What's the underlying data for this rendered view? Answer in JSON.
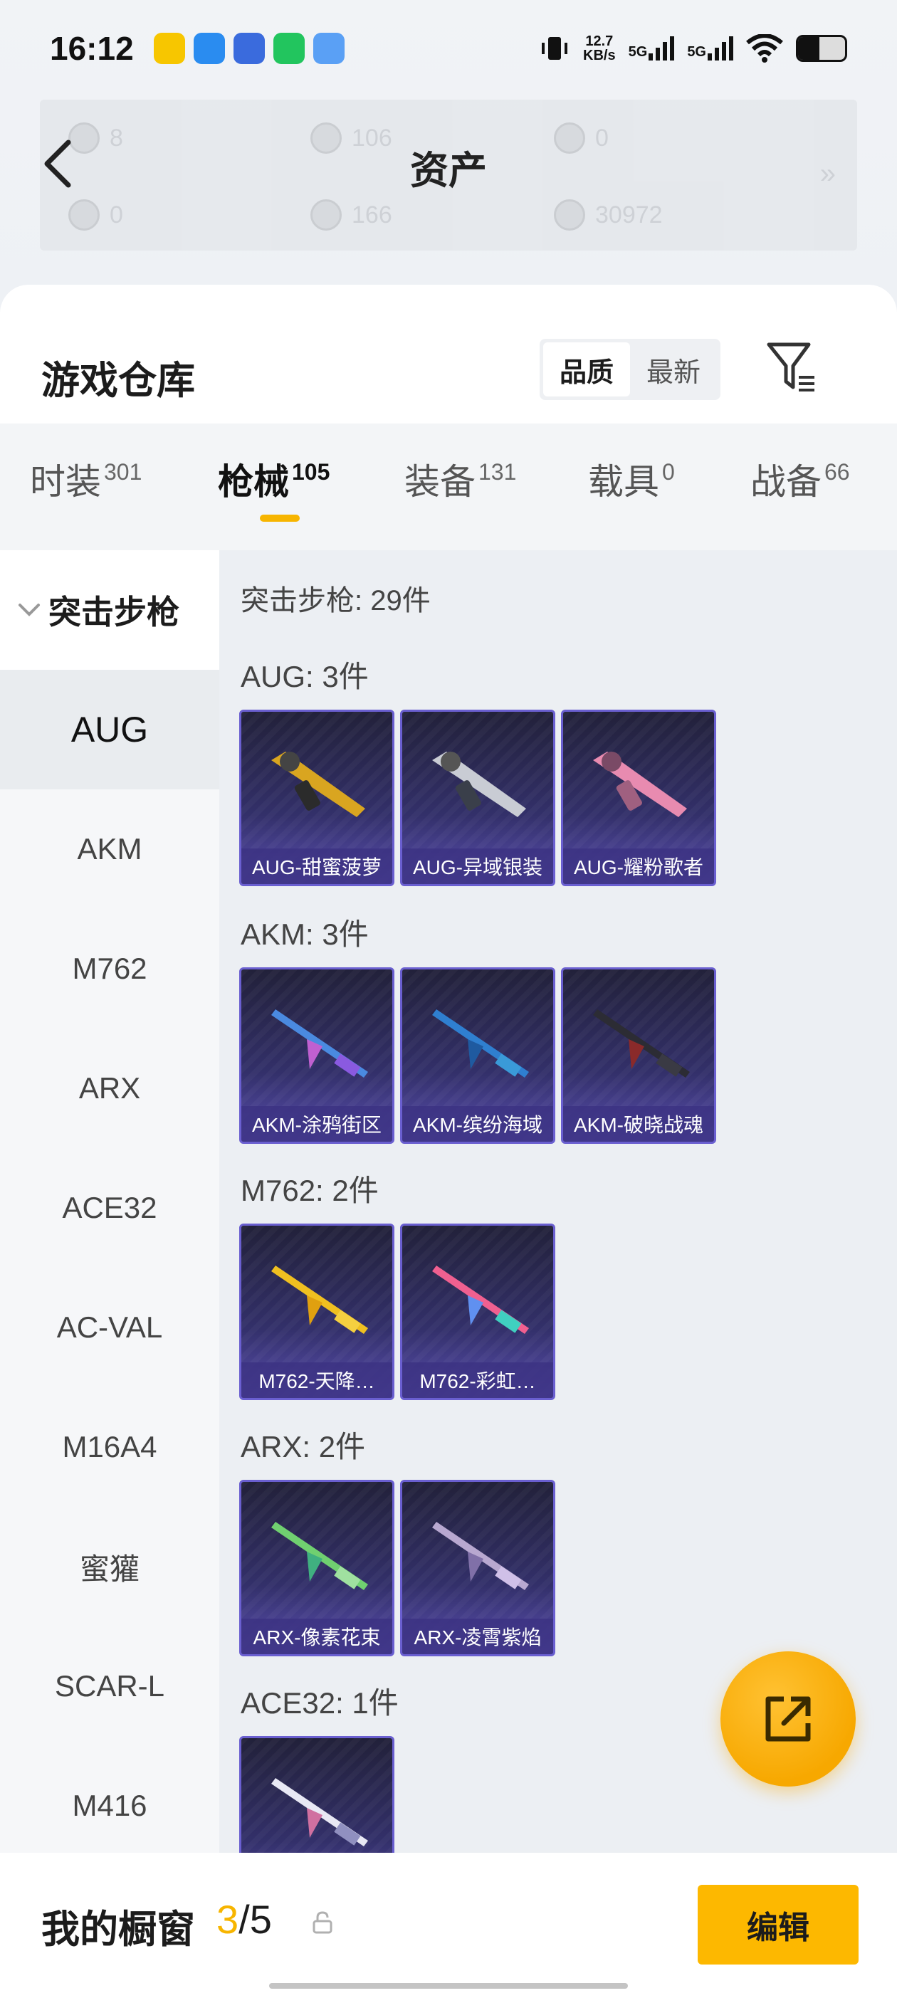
{
  "status_bar": {
    "time": "16:12",
    "net_speed_value": "12.7",
    "net_speed_unit": "KB/s",
    "signal1_label": "5G",
    "signal2_label": "5G",
    "battery_level": 0.45
  },
  "header": {
    "title": "资产",
    "assets": {
      "stat1": "8",
      "stat2": "106",
      "stat3": "0",
      "stat4": "0",
      "stat5": "166",
      "stat6": "30972"
    }
  },
  "warehouse": {
    "title": "游戏仓库",
    "sort_quality": "品质",
    "sort_latest": "最新"
  },
  "tabs": [
    {
      "label": "时装",
      "count": "301"
    },
    {
      "label": "枪械",
      "count": "105"
    },
    {
      "label": "装备",
      "count": "131"
    },
    {
      "label": "载具",
      "count": "0"
    },
    {
      "label": "战备",
      "count": "66"
    }
  ],
  "sidebar": {
    "category": "突击步枪",
    "items": [
      "AUG",
      "AKM",
      "M762",
      "ARX",
      "ACE32",
      "AC-VAL",
      "M16A4",
      "蜜獾",
      "SCAR-L",
      "M416"
    ]
  },
  "content": {
    "summary": "突击步枪: 29件",
    "groups": [
      {
        "title": "AUG: 3件",
        "items": [
          "AUG-甜蜜菠萝",
          "AUG-异域银装",
          "AUG-耀粉歌者"
        ]
      },
      {
        "title": "AKM: 3件",
        "items": [
          "AKM-涂鸦街区",
          "AKM-缤纷海域",
          "AKM-破晓战魂"
        ]
      },
      {
        "title": "M762: 2件",
        "items": [
          "M762-天降…",
          "M762-彩虹…"
        ]
      },
      {
        "title": "ARX: 2件",
        "items": [
          "ARX-像素花束",
          "ARX-凌霄紫焰"
        ]
      },
      {
        "title": "ACE32: 1件",
        "items": [
          ""
        ]
      }
    ]
  },
  "bottom": {
    "showcase_label": "我的橱窗",
    "showcase_current": "3",
    "showcase_total": "/5",
    "edit_label": "编辑"
  },
  "colors": {
    "accent": "#f7b500",
    "item_border": "#6a5fd0"
  }
}
